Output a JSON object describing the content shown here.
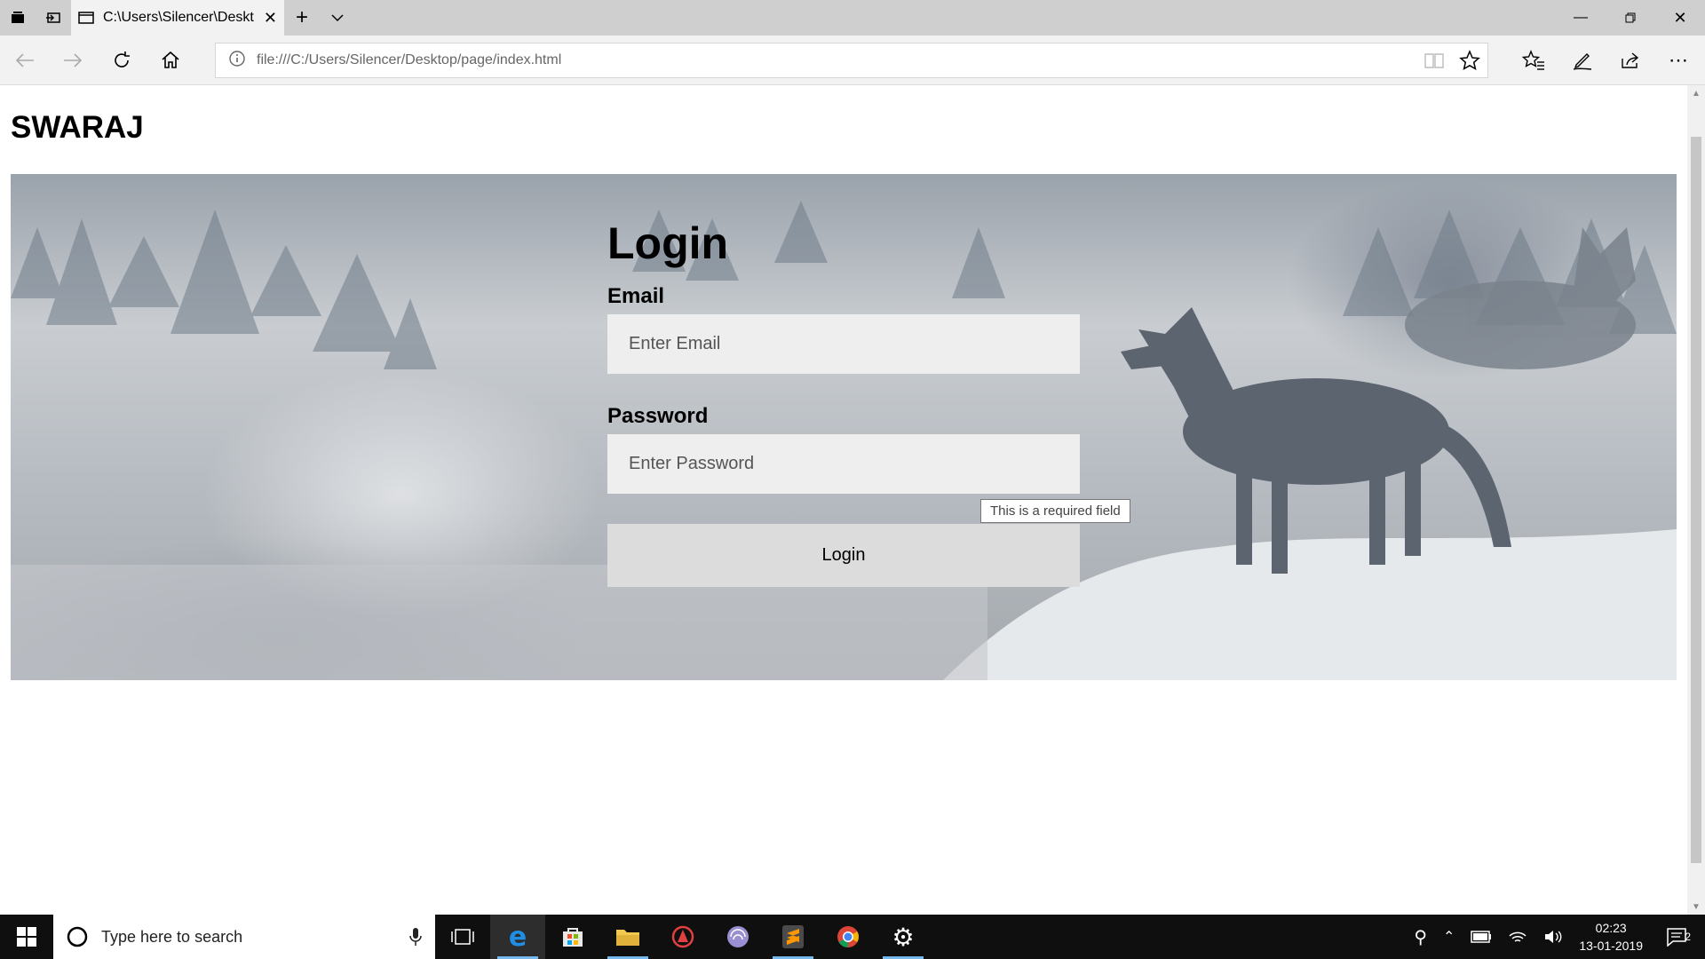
{
  "browser": {
    "tab": {
      "title": "C:\\Users\\Silencer\\Deskt"
    },
    "address_url": "file:///C:/Users/Silencer/Desktop/page/index.html"
  },
  "page": {
    "brand": "SWARAJ",
    "login": {
      "title": "Login",
      "email_label": "Email",
      "email_placeholder": "Enter Email",
      "password_label": "Password",
      "password_placeholder": "Enter Password",
      "button_label": "Login",
      "validation_tooltip": "This is a required field"
    }
  },
  "taskbar": {
    "search_placeholder": "Type here to search",
    "apps": [
      "task-view",
      "edge",
      "store",
      "file-explorer",
      "app-red",
      "app-purple",
      "sublime-text",
      "chrome",
      "settings"
    ],
    "time": "02:23",
    "date": "13-01-2019",
    "notification_count": "2"
  },
  "colors": {
    "taskbar_bg": "#0f0f0f",
    "edge_blue": "#0078d7",
    "active_indicator": "#76b9ed"
  }
}
